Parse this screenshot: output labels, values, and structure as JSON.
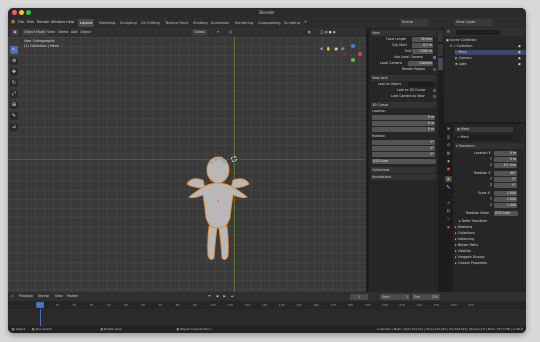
{
  "window": {
    "title": "Blender"
  },
  "menubar": {
    "items": [
      "File",
      "Edit",
      "Render",
      "Window",
      "Help"
    ],
    "workspaces": [
      "Layout",
      "Modeling",
      "Sculpting",
      "UV Editing",
      "Texture Paint",
      "Shading",
      "Animation",
      "Rendering",
      "Compositing",
      "Scripting"
    ],
    "scene": "Scene",
    "view_layer": "View Layer"
  },
  "viewport_header": {
    "mode": "Object Mode",
    "menus": [
      "View",
      "Select",
      "Add",
      "Object"
    ],
    "transform": "Global"
  },
  "viewport": {
    "view_name": "User Orthographic",
    "collection": "(1) Collection | Mesh"
  },
  "npanel": {
    "view_title": "View",
    "focal_length_label": "Focal Length",
    "focal_length": "50 mm",
    "clip_start_label": "Clip Start",
    "clip_start": "0.1 m",
    "clip_end_label": "End",
    "clip_end": "1000 m",
    "use_local_camera": "Use Local Camera",
    "local_camera_label": "Local Camera",
    "local_camera": "Camera",
    "render_region": "Render Region",
    "view_lock_title": "View Lock",
    "lock_object_label": "Lock to Object",
    "lock_3d_cursor": "Lock to 3D Cursor",
    "lock_camera": "Lock Camera to View",
    "cursor_title": "3D Cursor",
    "location_label": "Location",
    "cursor_x": "0 m",
    "cursor_y": "0 m",
    "cursor_z": "0 m",
    "rotation_label": "Rotation",
    "rot_x": "0°",
    "rot_y": "0°",
    "rot_z": "0°",
    "rot_mode": "XYZ Euler",
    "collections": "Collections",
    "annotations": "Annotations",
    "tabs": [
      "Item",
      "Tool",
      "View"
    ]
  },
  "outliner": {
    "root": "Scene Collection",
    "items": [
      "Collection",
      "Mesh",
      "Camera",
      "Light"
    ]
  },
  "properties": {
    "object_name": "Mesh",
    "data_name": "Mesh",
    "transform_title": "Transform",
    "location_label": "Location X",
    "loc_x": "0 m",
    "loc_y": "0 m",
    "loc_z": "-0.1 mm",
    "rotation_label": "Rotation X",
    "rot_x": "90°",
    "rot_y": "0°",
    "rot_z": "0°",
    "scale_label": "Scale X",
    "scale_x": "1.000",
    "scale_y": "1.000",
    "scale_z": "1.000",
    "rot_mode_label": "Rotation Mode",
    "rot_mode": "XYZ Euler",
    "axis_labels": [
      "Y",
      "Z"
    ],
    "sections": [
      "Delta Transform",
      "Relations",
      "Collections",
      "Instancing",
      "Motion Paths",
      "Visibility",
      "Viewport Display",
      "Custom Properties"
    ]
  },
  "timeline": {
    "menus": [
      "Playback",
      "Keying",
      "View",
      "Marker"
    ],
    "current_frame": "1",
    "start_label": "Start",
    "start": "1",
    "end_label": "End",
    "end": "250",
    "ticks": [
      "0",
      "10",
      "20",
      "30",
      "40",
      "50",
      "60",
      "70",
      "80",
      "90",
      "100",
      "110",
      "120",
      "130",
      "140",
      "150",
      "160",
      "170",
      "180",
      "190",
      "200",
      "210",
      "220",
      "230",
      "240",
      "250"
    ]
  },
  "statusbar": {
    "select": "Select",
    "box_select": "Box Select",
    "rotate_view": "Rotate View",
    "context_menu": "Object Context Menu",
    "stats": "Collection | Mesh | Verts:231,511 | Faces:231,916 | Tris:463,818 | Objects:1/3 | Mem: 133.3 MB | v2.90.0"
  },
  "colors": {
    "accent": "#4772b3",
    "selection": "#e88a2a",
    "grid_x": "#8a3a3a",
    "grid_y": "#6a8a2a"
  }
}
